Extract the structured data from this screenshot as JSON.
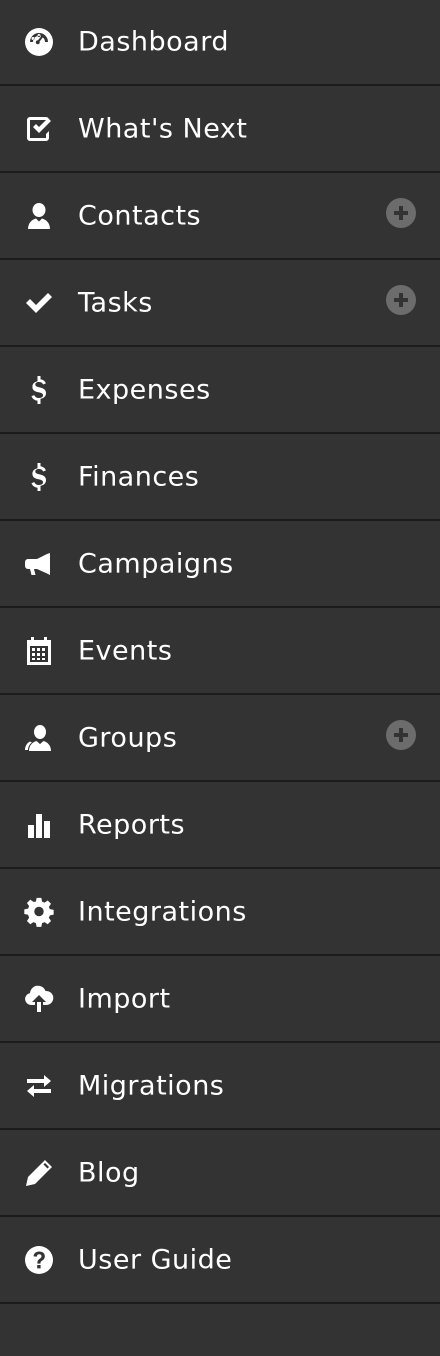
{
  "sidebar": {
    "items": [
      {
        "label": "Dashboard",
        "icon": "dashboard-icon",
        "has_add": false
      },
      {
        "label": "What's Next",
        "icon": "checkbox-icon",
        "has_add": false
      },
      {
        "label": "Contacts",
        "icon": "person-icon",
        "has_add": true
      },
      {
        "label": "Tasks",
        "icon": "checkmark-icon",
        "has_add": true
      },
      {
        "label": "Expenses",
        "icon": "dollar-icon",
        "has_add": false
      },
      {
        "label": "Finances",
        "icon": "dollar-icon",
        "has_add": false
      },
      {
        "label": "Campaigns",
        "icon": "megaphone-icon",
        "has_add": false
      },
      {
        "label": "Events",
        "icon": "calendar-icon",
        "has_add": false
      },
      {
        "label": "Groups",
        "icon": "group-icon",
        "has_add": true
      },
      {
        "label": "Reports",
        "icon": "bar-chart-icon",
        "has_add": false
      },
      {
        "label": "Integrations",
        "icon": "gear-icon",
        "has_add": false
      },
      {
        "label": "Import",
        "icon": "cloud-upload-icon",
        "has_add": false
      },
      {
        "label": "Migrations",
        "icon": "swap-arrows-icon",
        "has_add": false
      },
      {
        "label": "Blog",
        "icon": "pencil-icon",
        "has_add": false
      },
      {
        "label": "User Guide",
        "icon": "question-circle-icon",
        "has_add": false
      }
    ],
    "colors": {
      "background": "#333333",
      "divider": "#1c1c1c",
      "text": "#ffffff",
      "add_button": "#6c6c6c"
    }
  }
}
